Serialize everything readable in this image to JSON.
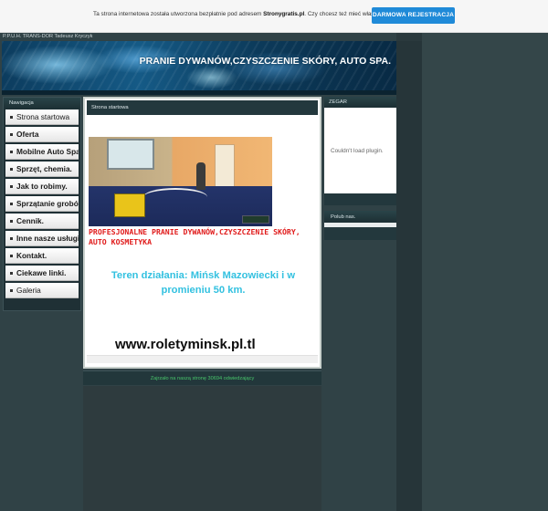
{
  "notice": {
    "text_prefix": "Ta strona internetowa została utworzona bezpłatnie pod adresem",
    "text_site": "Stronygratis.pl",
    "text_suffix": ". Czy chcesz też mieć własną stronę?",
    "button": "DARMOWA REJESTRACJA",
    "button_color": "#1f8ad8"
  },
  "company": "P.P.U.H. TRANS-DOR Tadeusz Kryczyk",
  "banner": {
    "title": "PRANIE DYWANÓW,CZYSZCZENIE SKÓRY, AUTO SPA."
  },
  "nav": {
    "header": "Nawigacja",
    "items": [
      {
        "label": "Strona startowa"
      },
      {
        "label": "Oferta"
      },
      {
        "label": "Mobilne Auto Spa."
      },
      {
        "label": "Sprzęt, chemia."
      },
      {
        "label": "Jak to robimy."
      },
      {
        "label": "Sprzątanie grobów."
      },
      {
        "label": "Cennik."
      },
      {
        "label": "Inne nasze usługi."
      },
      {
        "label": "Kontakt."
      },
      {
        "label": "Ciekawe linki."
      },
      {
        "label": "Galeria"
      }
    ]
  },
  "content": {
    "header": "Strona startowa",
    "red_text": "PROFESJONALNE PRANIE DYWANÓW,CZYSZCZENIE SKÓRY, AUTO KOSMETYKA",
    "cyan_text": "Teren działania: Mińsk Mazowiecki i w promieniu 50 km.",
    "url": "www.roletyminsk.pl.tl",
    "red_color": "#e01b1b",
    "cyan_color": "#33c1e0"
  },
  "counter": {
    "text": "Zajrzało na naszą stronę 30694 odwiedzający"
  },
  "right": {
    "clock_header": "ZEGAR",
    "plugin_message": "Couldn't load plugin.",
    "like_header": "Polub nas."
  }
}
